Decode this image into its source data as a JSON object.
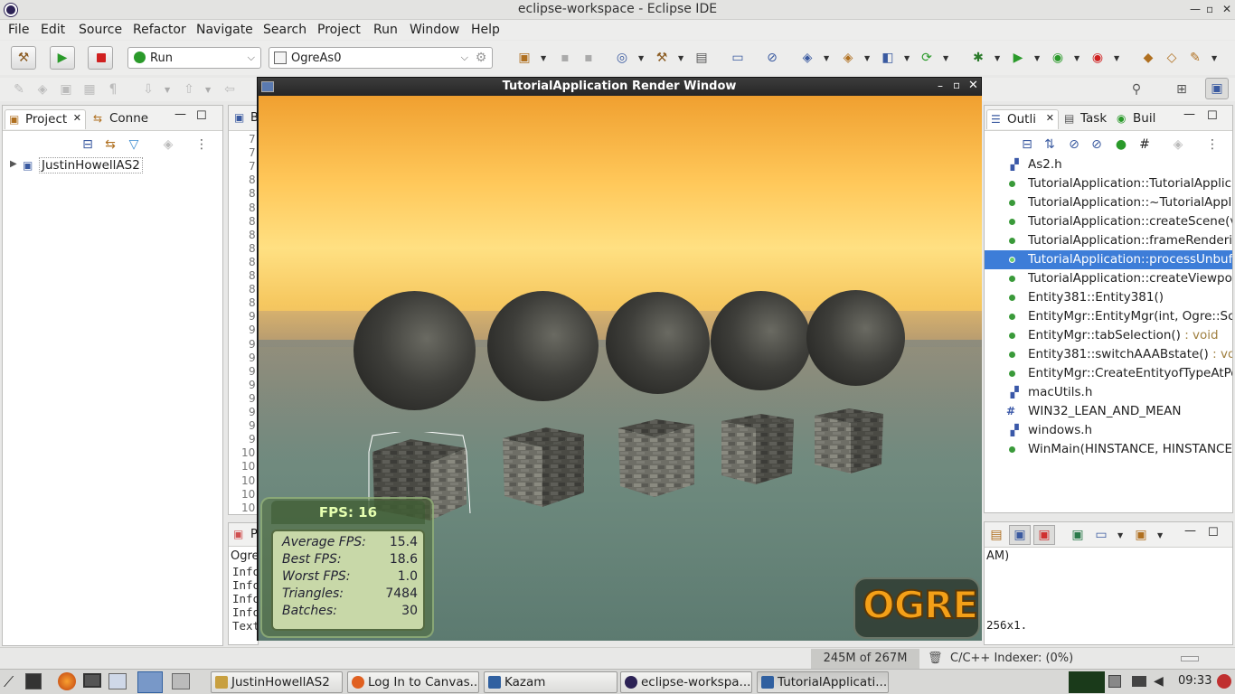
{
  "window": {
    "title": "eclipse-workspace - Eclipse IDE"
  },
  "menu": [
    "File",
    "Edit",
    "Source",
    "Refactor",
    "Navigate",
    "Search",
    "Project",
    "Run",
    "Window",
    "Help"
  ],
  "toolbar": {
    "launch_mode": "Run",
    "launch_config": "OgreAs0"
  },
  "project_panel": {
    "tab_project": "Project",
    "tab_connections": "Conne",
    "tree_root": "JustinHowellAS2"
  },
  "editor": {
    "tab_label": "B",
    "line_numbers": [
      "7",
      "7",
      "7",
      "8",
      "8",
      "8",
      "8",
      "8",
      "8",
      "8",
      "8",
      "8",
      "8",
      "9",
      "9",
      "9",
      "9",
      "9",
      "9",
      "9",
      "9",
      "9",
      "9",
      "10",
      "10",
      "10",
      "10",
      "10"
    ]
  },
  "console": {
    "tab_label": "P",
    "header": "Ogre",
    "lines": [
      "Info",
      "Info",
      "Info",
      "Info",
      "Text"
    ]
  },
  "outline_panel": {
    "tab_outline": "Outli",
    "tab_tasks": "Task",
    "tab_build": "Buil",
    "items": [
      {
        "kind": "include",
        "label": "As2.h",
        "ret": ""
      },
      {
        "kind": "method",
        "label": "TutorialApplication::TutorialApplica",
        "ret": ""
      },
      {
        "kind": "method",
        "label": "TutorialApplication::~TutorialApplic",
        "ret": ""
      },
      {
        "kind": "method",
        "label": "TutorialApplication::createScene(vo",
        "ret": ""
      },
      {
        "kind": "method",
        "label": "TutorialApplication::frameRenderin",
        "ret": ""
      },
      {
        "kind": "method",
        "label": "TutorialApplication::processUnbuffe",
        "ret": ""
      },
      {
        "kind": "method",
        "label": "TutorialApplication::createViewport",
        "ret": ""
      },
      {
        "kind": "method",
        "label": "Entity381::Entity381()",
        "ret": ""
      },
      {
        "kind": "method",
        "label": "EntityMgr::EntityMgr(int, Ogre::Scer",
        "ret": ""
      },
      {
        "kind": "method",
        "label": "EntityMgr::tabSelection()",
        "ret": " : void"
      },
      {
        "kind": "method",
        "label": "Entity381::switchAAABstate()",
        "ret": " : voic"
      },
      {
        "kind": "method",
        "label": "EntityMgr::CreateEntityofTypeAtPos",
        "ret": ""
      },
      {
        "kind": "include",
        "label": "macUtils.h",
        "ret": ""
      },
      {
        "kind": "define",
        "label": "WIN32_LEAN_AND_MEAN",
        "ret": ""
      },
      {
        "kind": "include",
        "label": "windows.h",
        "ret": ""
      },
      {
        "kind": "method",
        "label": "WinMain(HINSTANCE, HINSTANCE,",
        "ret": ""
      }
    ],
    "selected_index": 5
  },
  "lower_right": {
    "line1": "AM)",
    "line2": "256x1."
  },
  "status": {
    "heap": "245M of 267M",
    "indexer": "C/C++ Indexer: (0%)"
  },
  "render_window": {
    "title": "TutorialApplication Render Window",
    "fps": "FPS: 16",
    "stats": [
      {
        "label": "Average FPS:",
        "value": "15.4"
      },
      {
        "label": "Best FPS:",
        "value": "18.6"
      },
      {
        "label": "Worst FPS:",
        "value": "1.0"
      },
      {
        "label": "Triangles:",
        "value": "7484"
      },
      {
        "label": "Batches:",
        "value": "30"
      }
    ],
    "logo": "OGRE"
  },
  "taskbar": {
    "tasks": [
      {
        "label": "JustinHowellAS2",
        "icon": "folder-icon",
        "color": "#c8a040"
      },
      {
        "label": "Log In to Canvas...",
        "icon": "firefox-icon",
        "color": "#e06020"
      },
      {
        "label": "Kazam",
        "icon": "window-icon",
        "color": "#3060a0"
      },
      {
        "label": "eclipse-workspa...",
        "icon": "eclipse-icon",
        "color": "#2c2255"
      },
      {
        "label": "TutorialApplicati...",
        "icon": "window-icon",
        "color": "#3060a0"
      }
    ],
    "clock": "09:33"
  },
  "colors": {
    "selection": "#3d7dd8",
    "method_dot": "#3a9a3a",
    "ogre_orange": "#f4a018"
  }
}
